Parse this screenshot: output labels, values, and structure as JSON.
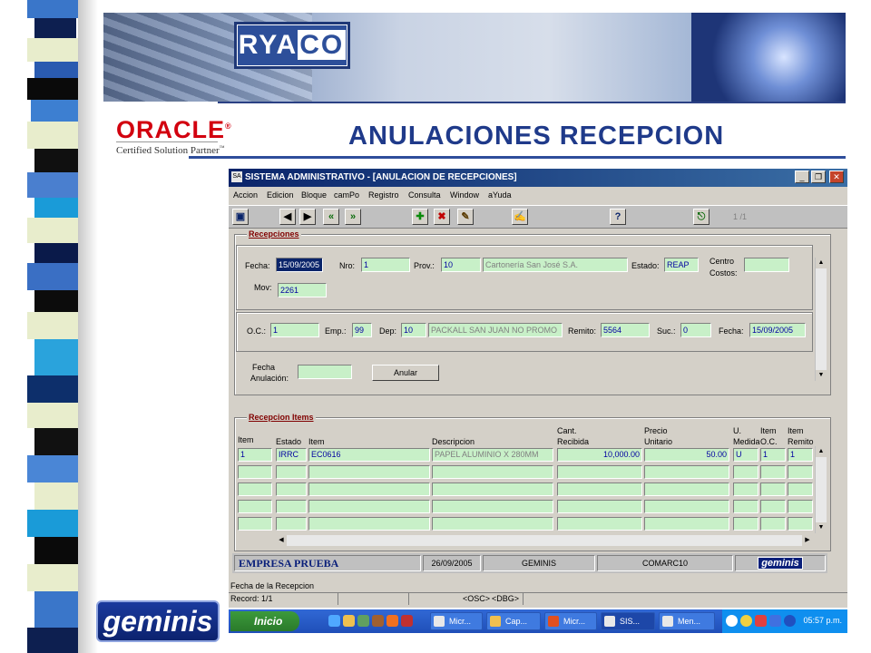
{
  "header": {
    "logo_text_a": "RYA",
    "logo_text_b": "CO",
    "oracle_brand": "ORACLE",
    "oracle_reg": "®",
    "oracle_sub": "Certified Solution Partner",
    "oracle_tm": "™",
    "title": "ANULACIONES  RECEPCION"
  },
  "window": {
    "title": "SISTEMA ADMINISTRATIVO - [ANULACION DE RECEPCIONES]",
    "icon": "app-icon",
    "menu": [
      "Accion",
      "Edicion",
      "Bloque",
      "camPo",
      "Registro",
      "Consulta",
      "Window",
      "aYuda"
    ],
    "record_counter": "1 /1"
  },
  "recepciones": {
    "title": "Recepciones",
    "fecha_label": "Fecha:",
    "fecha": "15/09/2005",
    "nro_label": "Nro:",
    "nro": "1",
    "prov_label": "Prov.:",
    "prov": "10",
    "prov_name": "Cartonería San José S.A.",
    "estado_label": "Estado:",
    "estado": "REAP",
    "centro_label1": "Centro",
    "centro_label2": "Costos:",
    "centro": "",
    "mov_label": "Mov:",
    "mov": "2261",
    "oc_label": "O.C.:",
    "oc": "1",
    "emp_label": "Emp.:",
    "emp": "99",
    "dep_label": "Dep:",
    "dep": "10",
    "dep_name": "PACKALL SAN JUAN  NO PROMO",
    "remito_label": "Remito:",
    "remito": "5564",
    "suc_label": "Suc.:",
    "suc": "0",
    "fecha2_label": "Fecha:",
    "fecha2": "15/09/2005",
    "anul_label1": "Fecha",
    "anul_label2": "Anulación:",
    "anul": "",
    "anular_button": "Anular"
  },
  "items": {
    "title": "Recepcion Items",
    "headers": {
      "item": "Item",
      "estado": "Estado",
      "item2": "Item",
      "descripcion": "Descripcion",
      "cant1": "Cant.",
      "cant2": "Recibida",
      "precio1": "Precio",
      "precio2": "Unitario",
      "um1": "U.",
      "um2": "Medida",
      "ioc1": "Item",
      "ioc2": "O.C.",
      "irem1": "Item",
      "irem2": "Remito"
    },
    "row": {
      "item": "1",
      "estado": "IRRC",
      "codigo": "EC0616",
      "descripcion": "PAPEL ALUMINIO X 280MM",
      "cantidad": "10,000.00",
      "precio": "50.00",
      "um": "U",
      "item_oc": "1",
      "item_remito": "1"
    }
  },
  "status": {
    "empresa": "EMPRESA PRUEBA",
    "fecha": "26/09/2005",
    "system": "GEMINIS",
    "user": "COMARC10",
    "logo": "geminis",
    "hint": "Fecha de la Recepcion",
    "record": "Record: 1/1",
    "osc": "<OSC>",
    "dbg": "<DBG>"
  },
  "taskbar": {
    "start": "Inicio",
    "tasks": [
      "Micr...",
      "Cap...",
      "Micr...",
      "SIS...",
      "Men..."
    ],
    "clock": "05:57 p.m."
  },
  "footer_logo": "geminis",
  "colors": {
    "title_blue": "#1f3a8a",
    "oracle_red": "#d2000f",
    "field_green": "#c8f0c8",
    "window_gray": "#d4d0c8",
    "titlebar_navy": "#0a246a"
  }
}
